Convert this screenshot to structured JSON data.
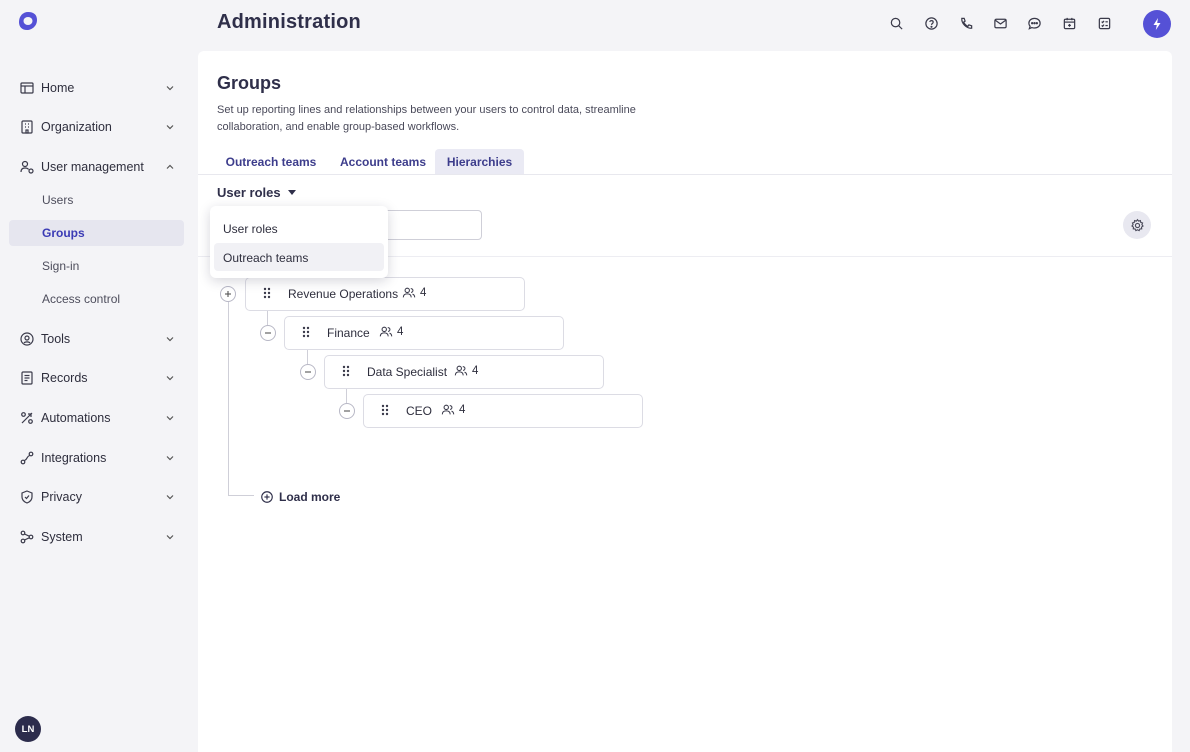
{
  "header": {
    "title": "Administration"
  },
  "sidebar": {
    "items": [
      {
        "label": "Home",
        "icon": "home-icon"
      },
      {
        "label": "Organization",
        "icon": "building-icon"
      },
      {
        "label": "User management",
        "icon": "users-icon",
        "expanded": true,
        "children": [
          "Users",
          "Groups",
          "Sign-in",
          "Access control"
        ],
        "active_child": "Groups"
      },
      {
        "label": "Tools",
        "icon": "tools-icon"
      },
      {
        "label": "Records",
        "icon": "records-icon"
      },
      {
        "label": "Automations",
        "icon": "automations-icon"
      },
      {
        "label": "Integrations",
        "icon": "integrations-icon"
      },
      {
        "label": "Privacy",
        "icon": "shield-icon"
      },
      {
        "label": "System",
        "icon": "system-icon"
      }
    ],
    "avatar_initials": "LN"
  },
  "main": {
    "title": "Groups",
    "description": "Set up reporting lines and relationships between your users to control data, streamline collaboration, and enable group-based workflows.",
    "tabs": [
      {
        "label": "Outreach teams"
      },
      {
        "label": "Account teams"
      },
      {
        "label": "Hierarchies",
        "active": true
      }
    ],
    "dropdown": {
      "selected": "User roles",
      "options": [
        "User roles",
        "Outreach teams"
      ]
    },
    "tree": [
      {
        "name": "Revenue Operations",
        "count": "4",
        "level": 0,
        "toggle": "+"
      },
      {
        "name": "Finance",
        "count": "4",
        "level": 1,
        "toggle": "−"
      },
      {
        "name": "Data Specialist",
        "count": "4",
        "level": 2,
        "toggle": "−"
      },
      {
        "name": "CEO",
        "count": "4",
        "level": 3,
        "toggle": "−"
      }
    ],
    "load_more": "Load more"
  },
  "colors": {
    "accent": "#5551d6",
    "active_text": "#3b3bb5",
    "tab_text": "#3d3d8c"
  }
}
